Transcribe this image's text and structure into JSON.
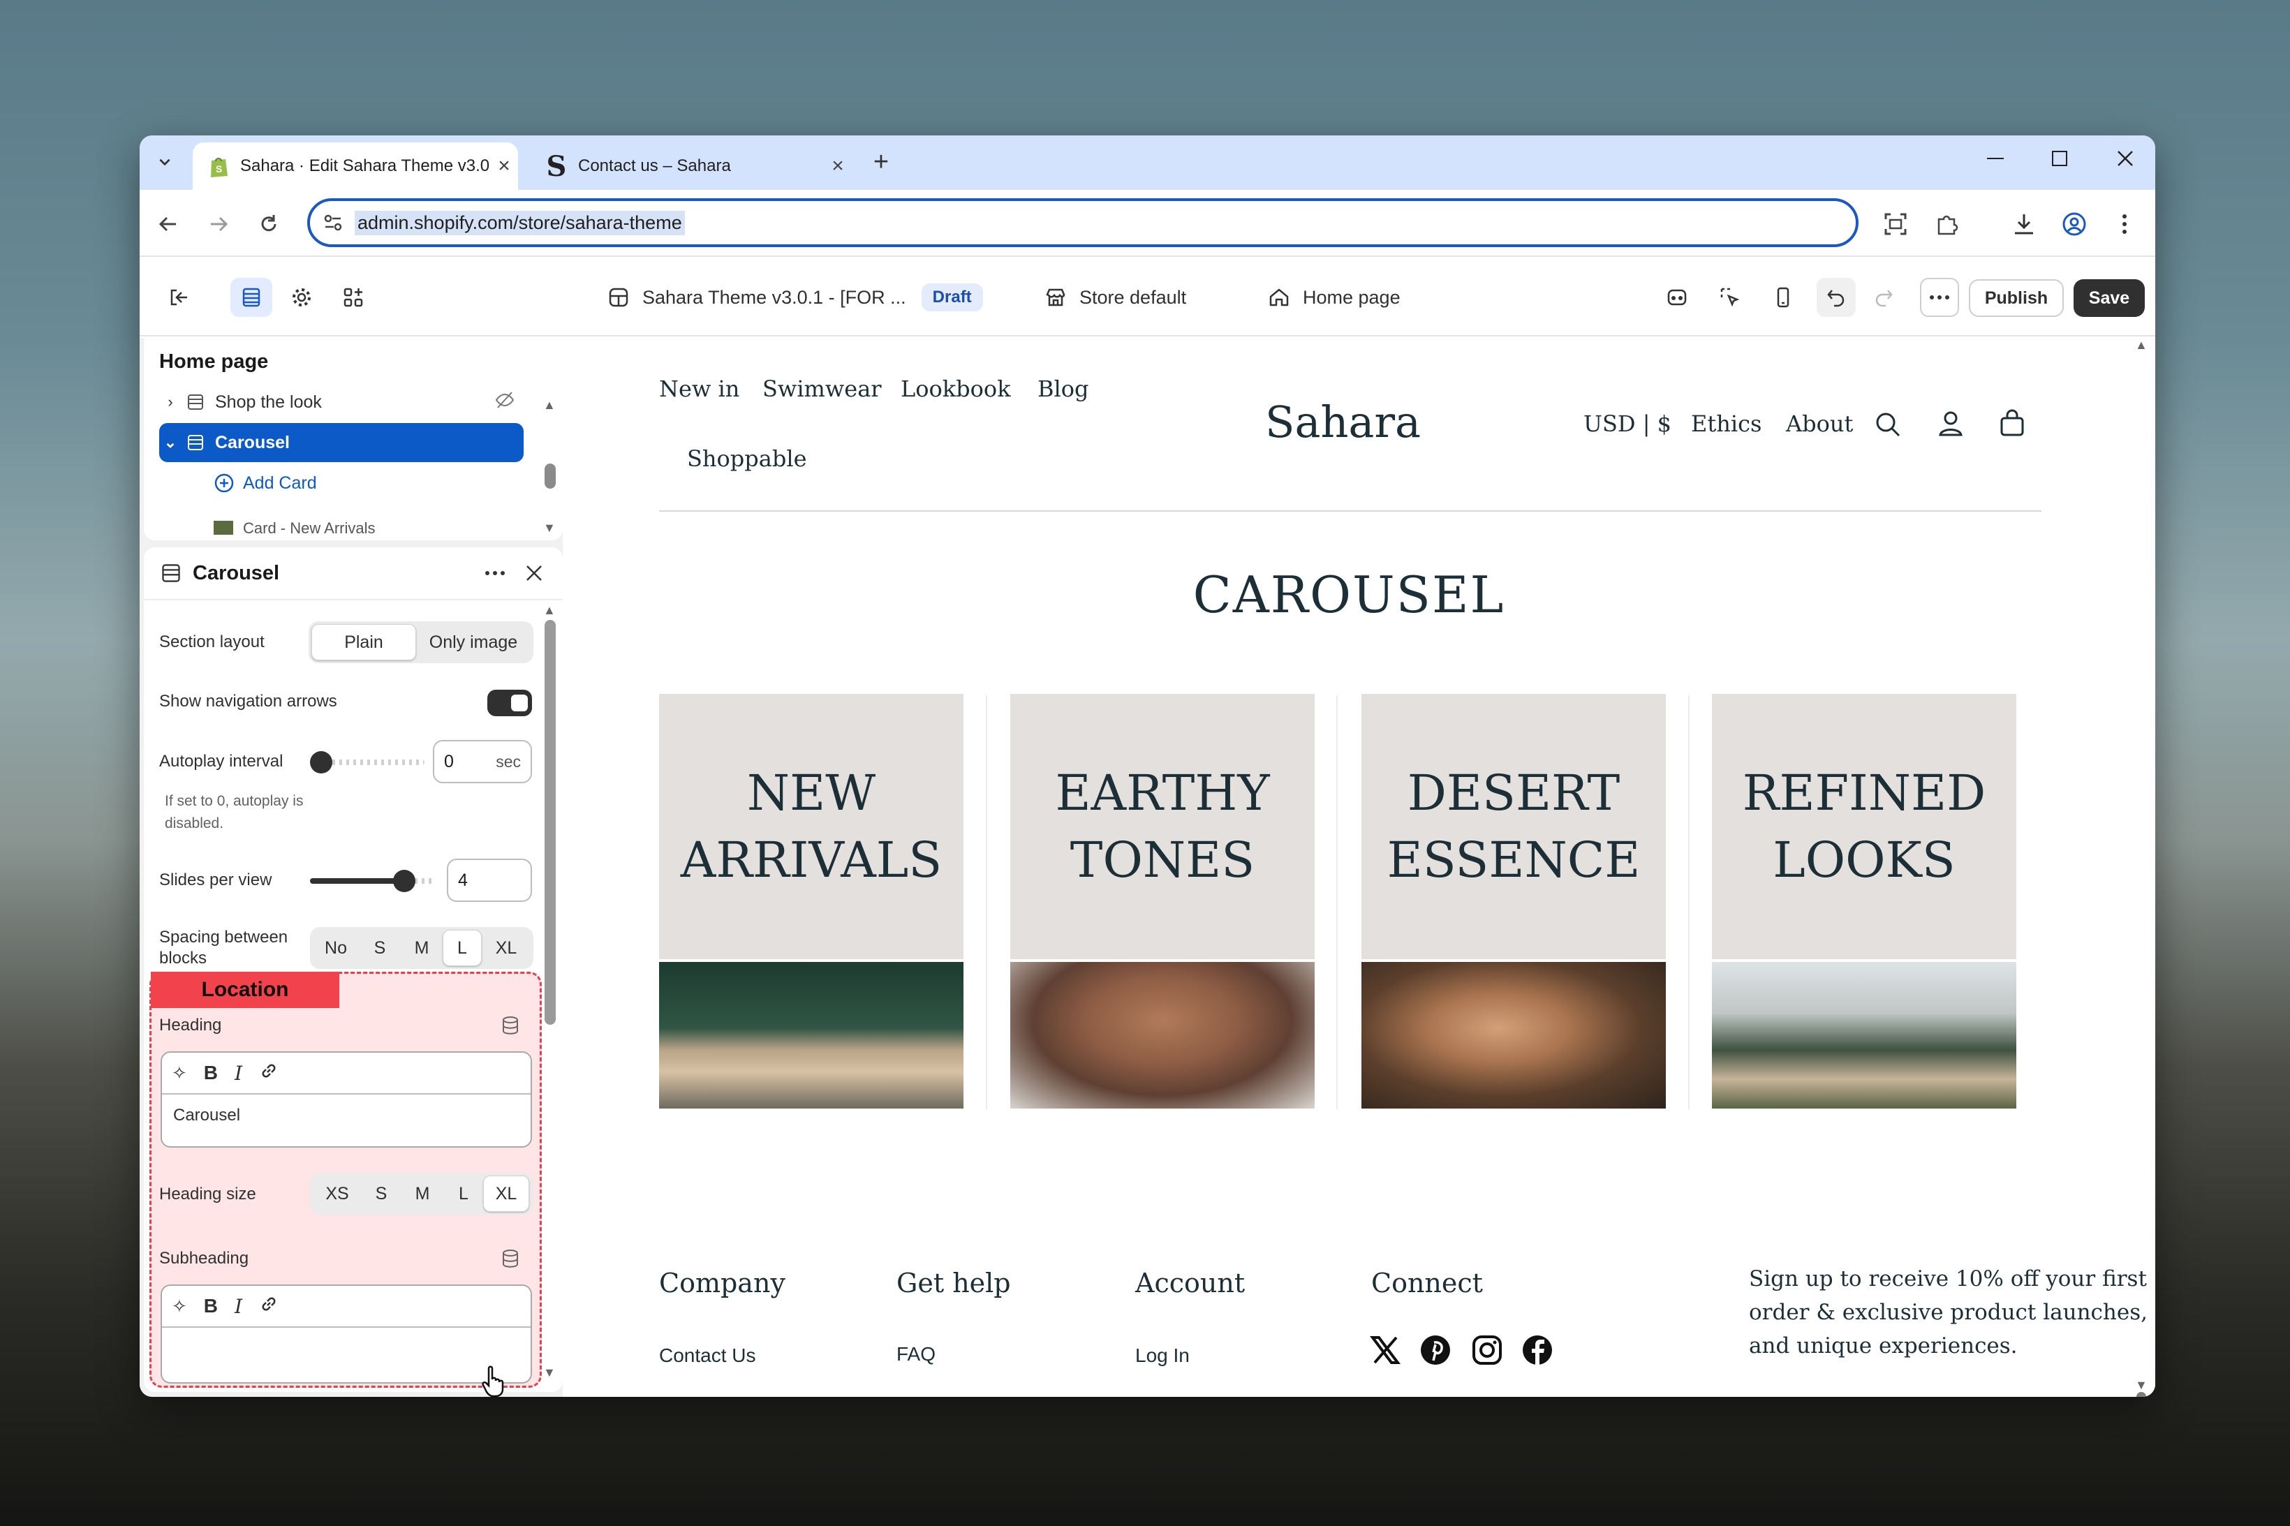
{
  "browser": {
    "tabs": [
      {
        "title": "Sahara · Edit Sahara Theme v3.0",
        "close": "×"
      },
      {
        "title": "Contact us – Sahara",
        "close": "×"
      }
    ],
    "new_tab": "+",
    "url": "admin.shopify.com/store/sahara-theme"
  },
  "toolbar": {
    "theme_name": "Sahara Theme v3.0.1 - [FOR ...",
    "status": "Draft",
    "store": "Store default",
    "page": "Home page",
    "publish": "Publish",
    "save": "Save"
  },
  "tree": {
    "title": "Home page",
    "items": [
      {
        "label": "Shop the look"
      },
      {
        "label": "Carousel"
      },
      {
        "label": "Add Card"
      },
      {
        "label": "Card - New Arrivals"
      }
    ]
  },
  "settings": {
    "title": "Carousel",
    "section_layout": {
      "label": "Section layout",
      "options": [
        "Plain",
        "Only image"
      ],
      "selected": "Plain"
    },
    "nav_arrows": {
      "label": "Show navigation arrows",
      "on": true
    },
    "autoplay": {
      "label": "Autoplay interval",
      "value": "0",
      "unit": "sec",
      "hint1": "If set to 0, autoplay is",
      "hint2": "disabled."
    },
    "slides": {
      "label": "Slides per view",
      "value": "4",
      "level": 0.75
    },
    "spacing": {
      "label1": "Spacing between",
      "label2": "blocks",
      "options": [
        "No",
        "S",
        "M",
        "L",
        "XL"
      ],
      "selected": "L"
    },
    "location_tag": "Location",
    "heading": {
      "label": "Heading",
      "value": "Carousel"
    },
    "heading_size": {
      "label": "Heading size",
      "options": [
        "XS",
        "S",
        "M",
        "L",
        "XL"
      ],
      "selected": "XL"
    },
    "subheading": {
      "label": "Subheading",
      "value": ""
    }
  },
  "store": {
    "nav_left": [
      "New in",
      "Swimwear",
      "Lookbook",
      "Blog",
      "Shoppable"
    ],
    "logo": "Sahara",
    "currency": "USD | $",
    "nav_right": [
      "Ethics",
      "About"
    ],
    "section_title": "CAROUSEL",
    "cards": [
      {
        "line1": "NEW",
        "line2": "ARRIVALS"
      },
      {
        "line1": "EARTHY",
        "line2": "TONES"
      },
      {
        "line1": "DESERT",
        "line2": "ESSENCE"
      },
      {
        "line1": "REFINED",
        "line2": "LOOKS"
      }
    ],
    "footer": {
      "cols": [
        {
          "heading": "Company",
          "link": "Contact Us"
        },
        {
          "heading": "Get help",
          "link": "FAQ"
        },
        {
          "heading": "Account",
          "link": "Log In"
        },
        {
          "heading": "Connect"
        }
      ],
      "signup": "Sign up to receive 10% off your first order & exclusive product launches, and unique experiences."
    }
  },
  "colors": {
    "accent": "#0b5ac8",
    "location": "#f2424c",
    "text": "#1c2e36"
  }
}
